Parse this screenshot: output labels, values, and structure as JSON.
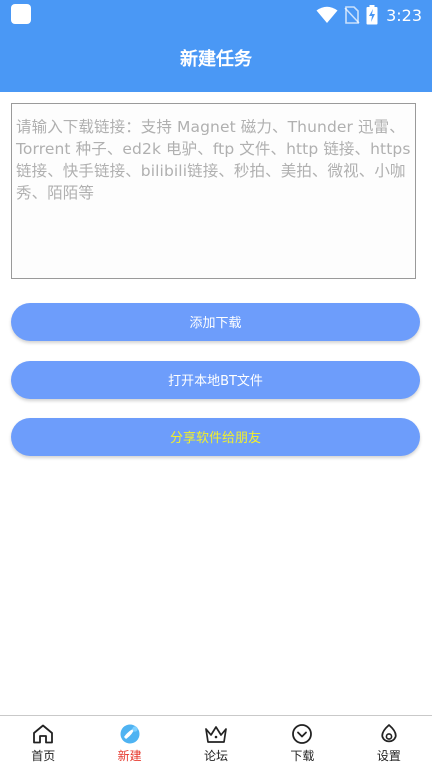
{
  "status_bar": {
    "time": "3:23"
  },
  "header": {
    "title": "新建任务"
  },
  "link_input": {
    "placeholder": "请输入下载链接：支持 Magnet 磁力、Thunder 迅雷、Torrent 种子、ed2k 电驴、ftp 文件、http 链接、https 链接、快手链接、bilibili链接、秒拍、美拍、微视、小咖秀、陌陌等",
    "value": ""
  },
  "buttons": {
    "add_download": "添加下载",
    "open_bt_file": "打开本地BT文件",
    "share_app": "分享软件给朋友"
  },
  "bottom_nav": {
    "items": [
      {
        "label": "首页",
        "icon": "home-icon"
      },
      {
        "label": "新建",
        "icon": "new-task-icon",
        "active": true
      },
      {
        "label": "论坛",
        "icon": "crown-icon"
      },
      {
        "label": "下载",
        "icon": "download-icon"
      },
      {
        "label": "设置",
        "icon": "settings-icon"
      }
    ]
  },
  "colors": {
    "header": "#4a98f5",
    "button": "#6d9dfb",
    "share_text": "#f3f02a",
    "active_nav": "#e6382d"
  }
}
